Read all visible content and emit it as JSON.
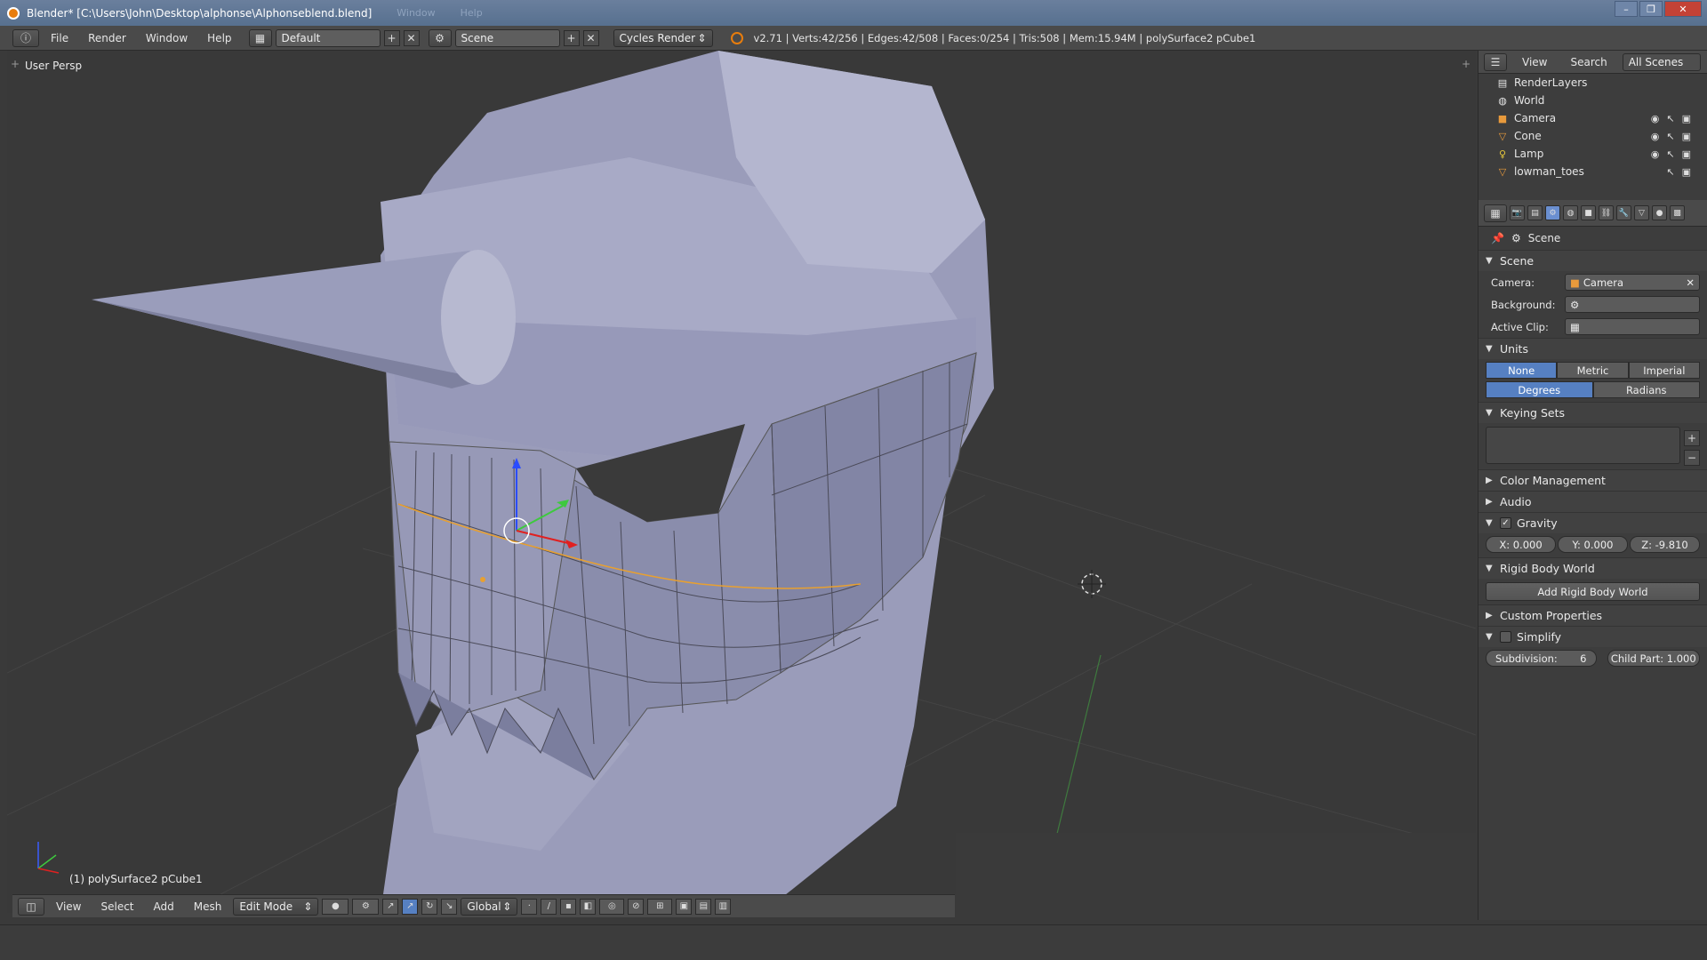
{
  "window": {
    "title": "Blender* [C:\\Users\\John\\Desktop\\alphonse\\Alphonseblend.blend]",
    "ghost_menu": [
      "Window",
      "Help"
    ],
    "buttons": [
      "–",
      "❐",
      "✕"
    ]
  },
  "infobar": {
    "menus": [
      "File",
      "Render",
      "Window",
      "Help"
    ],
    "layout": "Default",
    "scene": "Scene",
    "engine": "Cycles Render",
    "stats": "v2.71 | Verts:42/256 | Edges:42/508 | Faces:0/254 | Tris:508 | Mem:15.94M | polySurface2 pCube1"
  },
  "viewport": {
    "label": "User Persp",
    "object_name": "(1) polySurface2 pCube1",
    "header": {
      "menus": [
        "View",
        "Select",
        "Add",
        "Mesh"
      ],
      "mode": "Edit Mode",
      "orientation": "Global"
    }
  },
  "outliner": {
    "header": [
      "View",
      "Search",
      "All Scenes"
    ],
    "items": [
      {
        "label": "RenderLayers",
        "icon": "renderlayers-icon"
      },
      {
        "label": "World",
        "icon": "world-icon"
      },
      {
        "label": "Camera",
        "icon": "camera-icon"
      },
      {
        "label": "Cone",
        "icon": "mesh-icon"
      },
      {
        "label": "Lamp",
        "icon": "lamp-icon"
      },
      {
        "label": "lowman_toes",
        "icon": "mesh-icon"
      }
    ]
  },
  "properties": {
    "breadcrumb": "Scene",
    "scene_panel": {
      "title": "Scene",
      "camera_label": "Camera:",
      "camera_value": "Camera",
      "background_label": "Background:",
      "active_clip_label": "Active Clip:"
    },
    "units_panel": {
      "title": "Units",
      "systems": [
        "None",
        "Metric",
        "Imperial"
      ],
      "rotation": [
        "Degrees",
        "Radians"
      ]
    },
    "keying_sets_title": "Keying Sets",
    "color_management_title": "Color Management",
    "audio_title": "Audio",
    "gravity": {
      "title": "Gravity",
      "x": "X:  0.000",
      "y": "Y:  0.000",
      "z": "Z:  -9.810"
    },
    "rigid_body": {
      "title": "Rigid Body World",
      "button": "Add Rigid Body World"
    },
    "custom_properties_title": "Custom Properties",
    "simplify": {
      "title": "Simplify",
      "subdivision": "Subdivision:",
      "subdivision_value": "6",
      "child_part": "Child Part: 1.000"
    }
  },
  "colors": {
    "accent": "#5680c2",
    "selected_edge": "#e8a030",
    "mesh": "#8f93b5"
  }
}
